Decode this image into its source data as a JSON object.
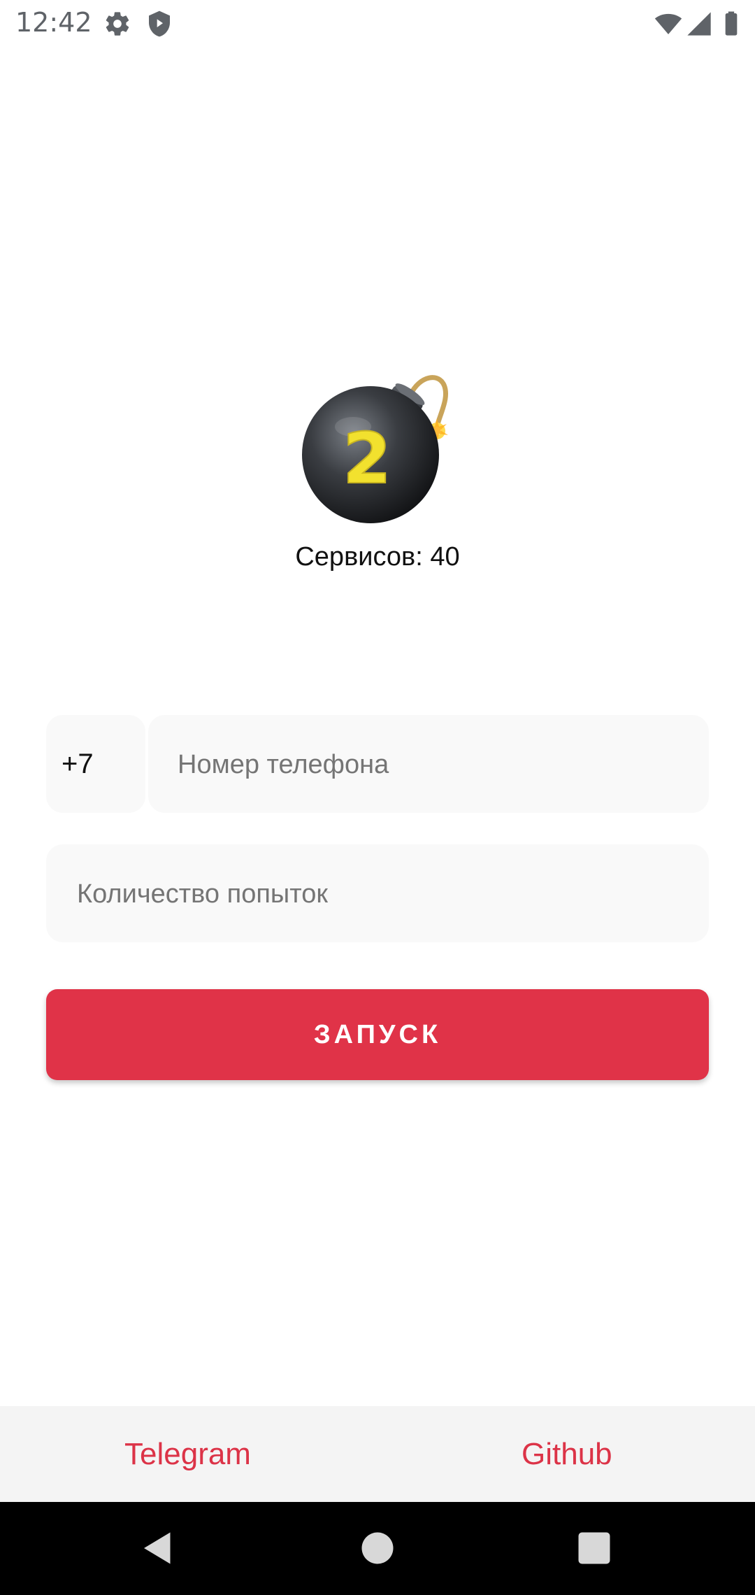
{
  "status_bar": {
    "time": "12:42",
    "icons": [
      "gear-icon",
      "shield-icon",
      "wifi-icon",
      "signal-icon",
      "battery-icon"
    ]
  },
  "logo": {
    "icon": "bomb-icon",
    "number": "2"
  },
  "services_text": "Сервисов: 40",
  "form": {
    "country_code": "+7",
    "phone_placeholder": "Номер телефона",
    "attempts_placeholder": "Количество попыток",
    "launch_label": "ЗАПУСК"
  },
  "footer": {
    "telegram_label": "Telegram",
    "github_label": "Github"
  },
  "colors": {
    "accent": "#e03348",
    "field_bg": "#f9f9f9",
    "footer_bg": "#f4f4f4",
    "nav_bg": "#000000"
  },
  "nav": {
    "icons": [
      "back-icon",
      "home-icon",
      "recents-icon"
    ]
  }
}
